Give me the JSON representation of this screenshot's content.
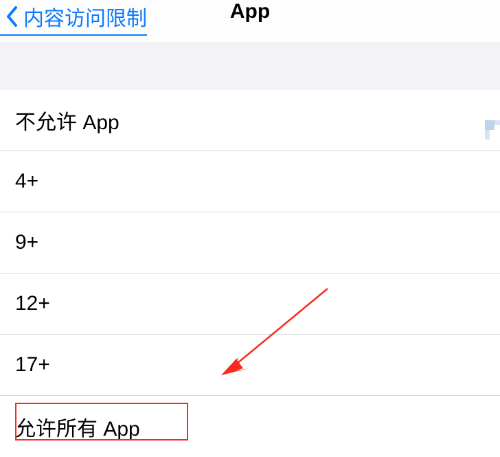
{
  "header": {
    "back_label": "内容访问限制",
    "title": "App"
  },
  "options": [
    {
      "label": "不允许 App"
    },
    {
      "label": "4+"
    },
    {
      "label": "9+"
    },
    {
      "label": "12+"
    },
    {
      "label": "17+"
    },
    {
      "label": "允许所有 App"
    }
  ]
}
